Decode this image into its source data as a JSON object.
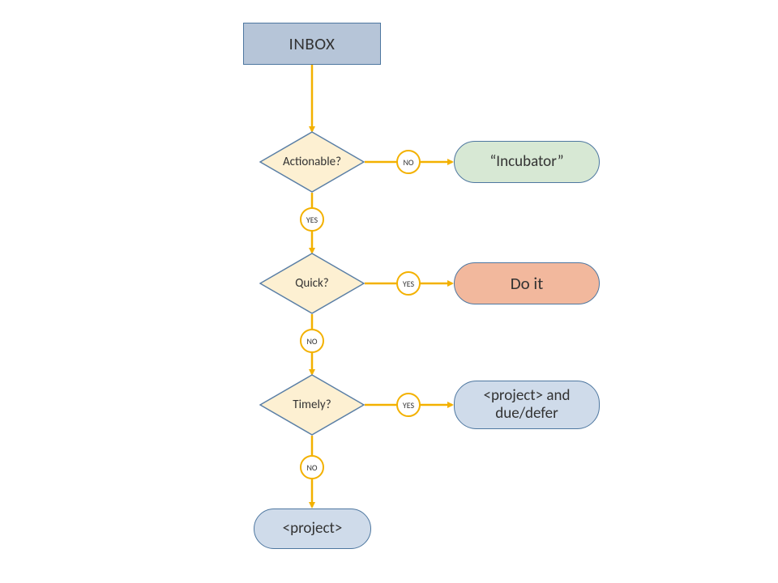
{
  "colors": {
    "arrow": "#f3b100",
    "diamond_fill": "#fdf0d2",
    "diamond_stroke": "#5a7fa6",
    "rect_fill": "#b6c5d8",
    "rect_stroke": "#4e77a0",
    "pill_green": "#d7e8d4",
    "pill_orange": "#f2b89d",
    "pill_blue": "#cfdbea"
  },
  "nodes": {
    "inbox": {
      "label": "INBOX"
    },
    "actionable": {
      "label": "Actionable?"
    },
    "quick": {
      "label": "Quick?"
    },
    "timely": {
      "label": "Timely?"
    },
    "incubator": {
      "label": "“Incubator”"
    },
    "doit": {
      "label": "Do it"
    },
    "project_due": {
      "label": "<project> and due/defer"
    },
    "project": {
      "label": "<project>"
    }
  },
  "badges": {
    "actionable_no": "NO",
    "actionable_yes": "YES",
    "quick_yes": "YES",
    "quick_no": "NO",
    "timely_yes": "YES",
    "timely_no": "NO"
  }
}
